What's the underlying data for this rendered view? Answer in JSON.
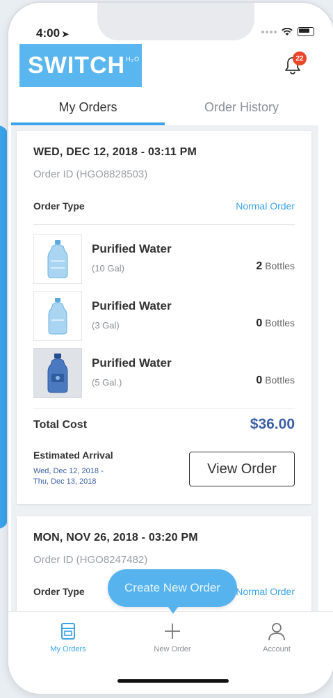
{
  "status_bar": {
    "time": "4:00",
    "arrow": "➤"
  },
  "header": {
    "logo_text": "SWITCH",
    "logo_sup": "H₂O",
    "notification_count": "22"
  },
  "tabs": [
    {
      "label": "My Orders",
      "active": true
    },
    {
      "label": "Order History",
      "active": false
    }
  ],
  "orders": [
    {
      "date": "WED, DEC 12, 2018 - 03:11 PM",
      "order_id": "Order ID (HGO8828503)",
      "order_type_label": "Order Type",
      "order_type": "Normal Order",
      "items": [
        {
          "name": "Purified Water",
          "size": "(10 Gal)",
          "qty": "2",
          "unit": "Bottles"
        },
        {
          "name": "Purified Water",
          "size": "(3 Gal)",
          "qty": "0",
          "unit": "Bottles"
        },
        {
          "name": "Purified Water",
          "size": "(5 Gal.)",
          "qty": "0",
          "unit": "Bottles"
        }
      ],
      "total_label": "Total Cost",
      "total": "$36.00",
      "eta_label": "Estimated Arrival",
      "eta_line1": "Wed, Dec 12, 2018 -",
      "eta_line2": "Thu, Dec 13, 2018",
      "view_label": "View Order"
    },
    {
      "date": "MON, NOV 26, 2018 - 03:20 PM",
      "order_id": "Order ID (HGO8247482)",
      "order_type_label": "Order Type",
      "order_type": "Normal Order"
    }
  ],
  "create_order_label": "Create New Order",
  "bottom_nav": [
    {
      "label": "My Orders",
      "icon": "orders-icon"
    },
    {
      "label": "New Order",
      "icon": "plus-icon"
    },
    {
      "label": "Account",
      "icon": "user-icon"
    }
  ],
  "colors": {
    "accent": "#3aa3ea",
    "price": "#3b5fa8",
    "badge": "#e9462b"
  }
}
